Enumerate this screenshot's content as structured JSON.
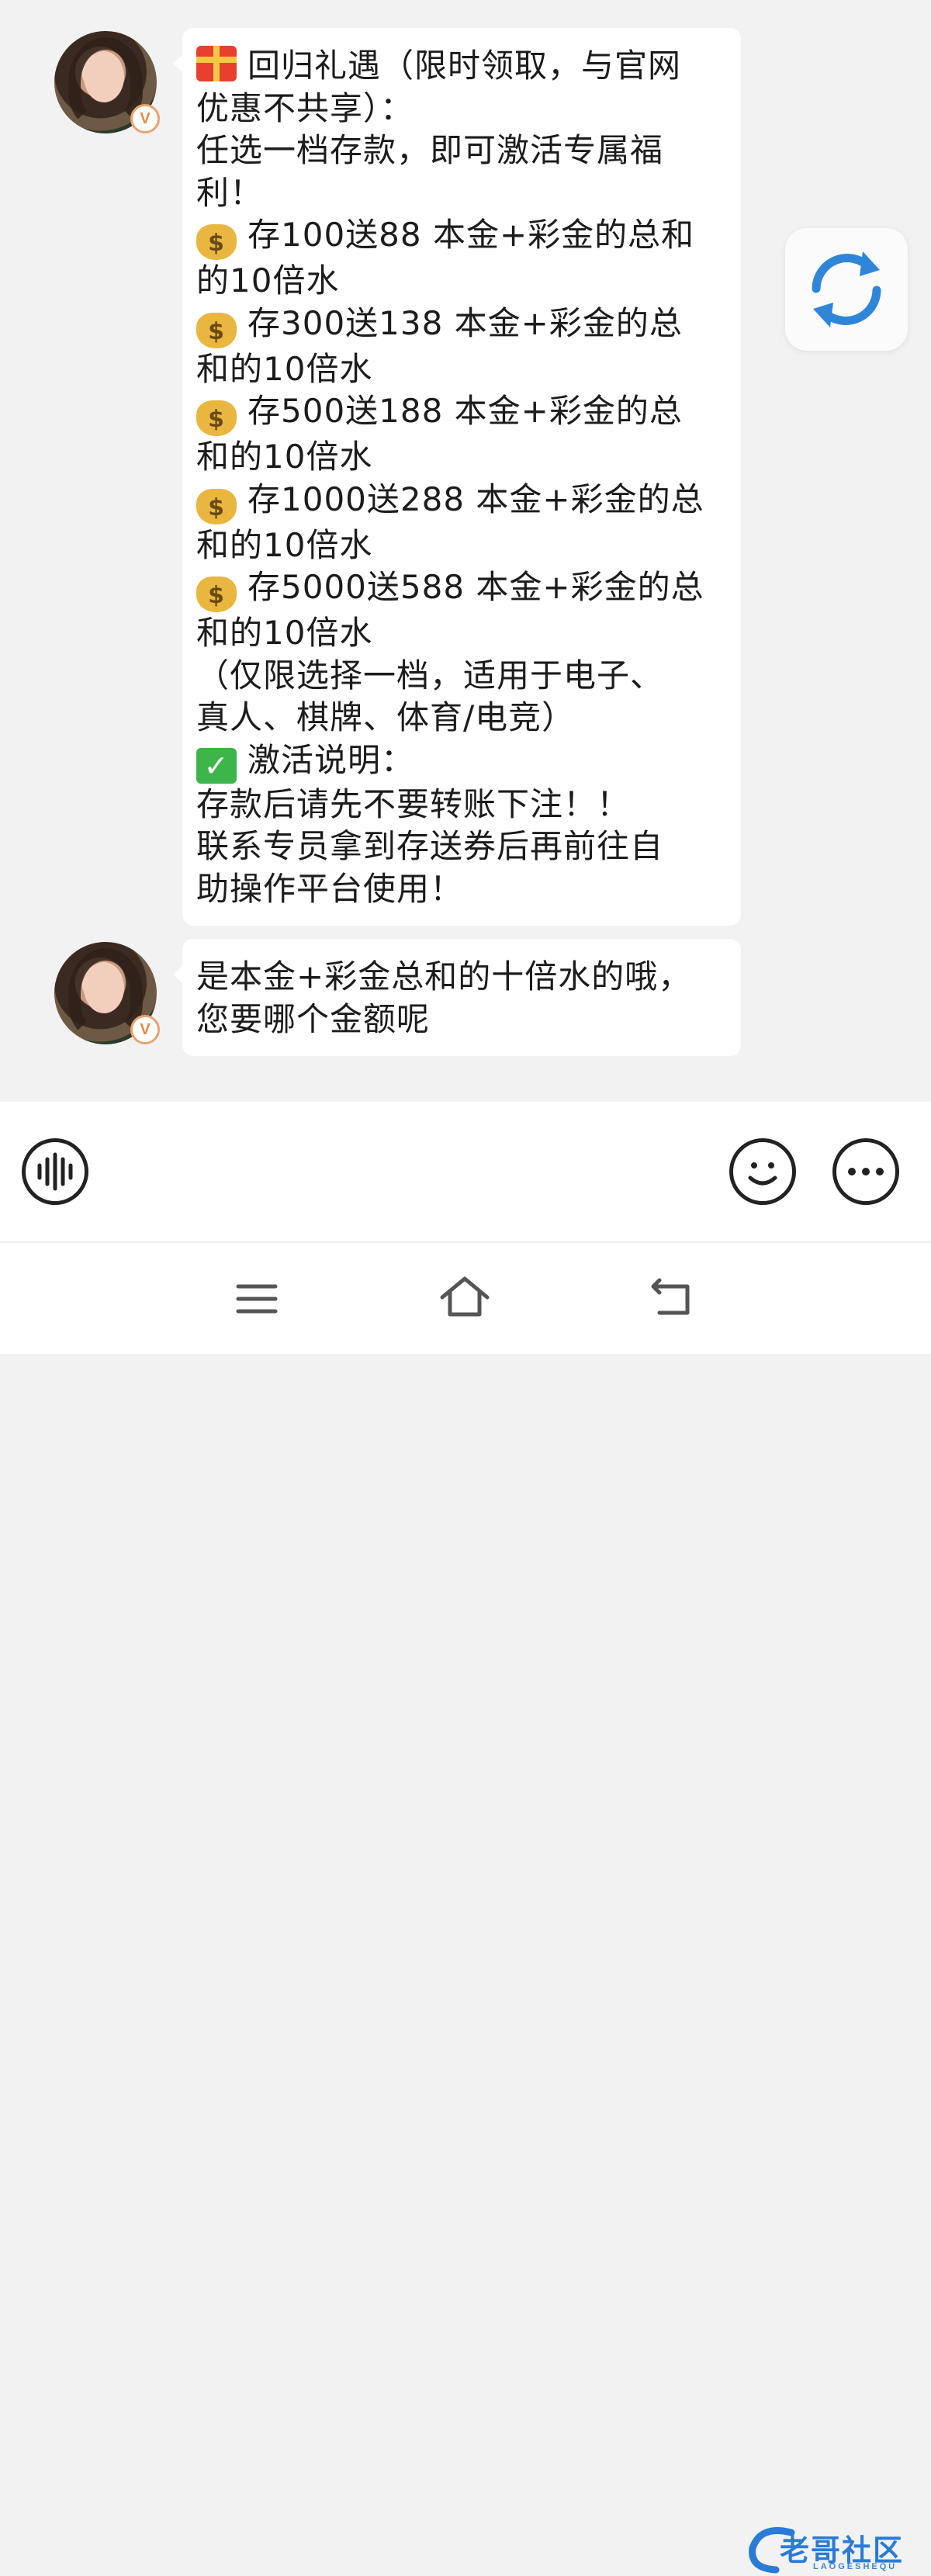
{
  "messages": [
    {
      "sender": "agent",
      "verified_badge": "V",
      "lines": [
        {
          "icon": "gift",
          "text": "回归礼遇（限时领取，与官网"
        },
        {
          "icon": null,
          "text": "优惠不共享）："
        },
        {
          "icon": null,
          "text": "任选一档存款，即可激活专属福"
        },
        {
          "icon": null,
          "text": "利！"
        },
        {
          "icon": "money-bag",
          "text": "存100送88 本金+彩金的总和"
        },
        {
          "icon": null,
          "text": "的10倍水"
        },
        {
          "icon": "money-bag",
          "text": "存300送138 本金+彩金的总"
        },
        {
          "icon": null,
          "text": "和的10倍水"
        },
        {
          "icon": "money-bag",
          "text": "存500送188 本金+彩金的总"
        },
        {
          "icon": null,
          "text": "和的10倍水"
        },
        {
          "icon": "money-bag",
          "text": "存1000送288 本金+彩金的总"
        },
        {
          "icon": null,
          "text": "和的10倍水"
        },
        {
          "icon": "money-bag",
          "text": "存5000送588 本金+彩金的总"
        },
        {
          "icon": null,
          "text": "和的10倍水"
        },
        {
          "icon": null,
          "text": "（仅限选择一档，适用于电子、"
        },
        {
          "icon": null,
          "text": "真人、棋牌、体育/电竞）"
        },
        {
          "icon": "check-mark",
          "text": "激活说明："
        },
        {
          "icon": null,
          "text": "存款后请先不要转账下注！！"
        },
        {
          "icon": null,
          "text": "联系专员拿到存送券后再前往自"
        },
        {
          "icon": null,
          "text": "助操作平台使用！"
        }
      ]
    },
    {
      "sender": "agent",
      "verified_badge": "V",
      "lines": [
        {
          "icon": null,
          "text": "是本金+彩金总和的十倍水的哦，"
        },
        {
          "icon": null,
          "text": "您要哪个金额呢"
        }
      ]
    }
  ],
  "toolbar": {
    "voice_icon": "voice-waveform-icon",
    "emoji_icon": "smiley-icon",
    "more_icon": "more-dots-icon"
  },
  "floating": {
    "refresh_icon": "refresh-icon",
    "accent": "#2f86d8"
  },
  "navbar": {
    "menu_icon": "menu-icon",
    "home_icon": "home-icon",
    "back_icon": "back-icon"
  },
  "watermark": {
    "title": "老哥社区",
    "subtitle": "LAOGESHEQU"
  },
  "colors": {
    "background": "#f2f2f2",
    "bubble": "#ffffff",
    "badge": "#e08a4c"
  }
}
